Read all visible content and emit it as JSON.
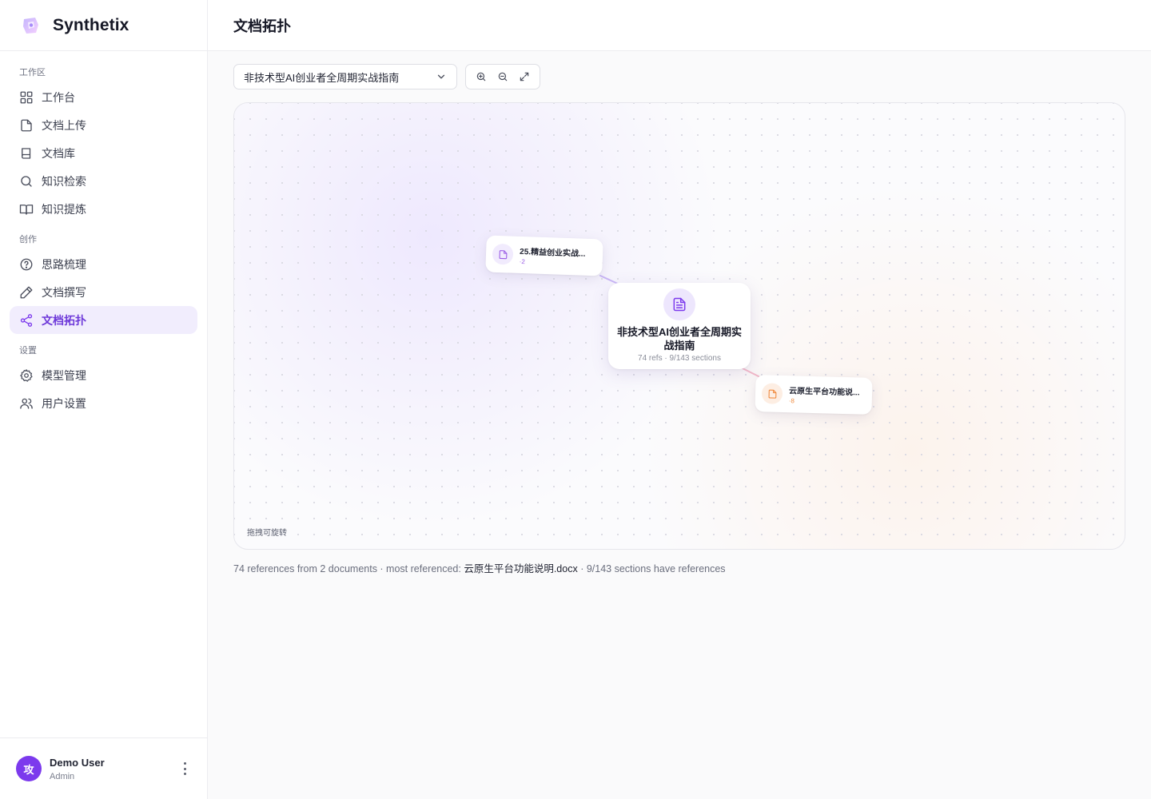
{
  "app": {
    "name": "Synthetix"
  },
  "sidebar": {
    "sections": [
      {
        "label": "工作区",
        "items": [
          {
            "label": "工作台",
            "icon": "grid-icon"
          },
          {
            "label": "文档上传",
            "icon": "file-icon"
          },
          {
            "label": "文档库",
            "icon": "book-icon"
          },
          {
            "label": "知识检索",
            "icon": "search-icon"
          },
          {
            "label": "知识提炼",
            "icon": "book-open-icon"
          }
        ]
      },
      {
        "label": "创作",
        "items": [
          {
            "label": "思路梳理",
            "icon": "help-circle-icon"
          },
          {
            "label": "文档撰写",
            "icon": "pencil-icon"
          },
          {
            "label": "文档拓扑",
            "icon": "share-icon",
            "active": true
          }
        ]
      },
      {
        "label": "设置",
        "items": [
          {
            "label": "模型管理",
            "icon": "gear-icon"
          },
          {
            "label": "用户设置",
            "icon": "users-icon"
          }
        ]
      }
    ]
  },
  "user": {
    "initial": "攻",
    "name": "Demo User",
    "role": "Admin"
  },
  "header": {
    "title": "文档拓扑"
  },
  "toolbar": {
    "selected_document": "非技术型AI创业者全周期实战指南"
  },
  "graph": {
    "center": {
      "title": "非技术型AI创业者全周期实战指南",
      "meta": "74 refs · 9/143 sections"
    },
    "neighbors": [
      {
        "name": "25.精益创业实战...",
        "count": "·2",
        "color": "#9b5de5"
      },
      {
        "name": "云原生平台功能说...",
        "count": "·8",
        "color": "#f08a3e"
      }
    ],
    "hint": "拖拽可旋转"
  },
  "stats": {
    "prefix": "74 references from 2 documents · most referenced: ",
    "most_referenced": "云原生平台功能说明.docx",
    "suffix": " · 9/143 sections have references"
  },
  "colors": {
    "accent": "#7c3aed",
    "accent_bg": "#f1edfd",
    "orange": "#f08a3e"
  }
}
